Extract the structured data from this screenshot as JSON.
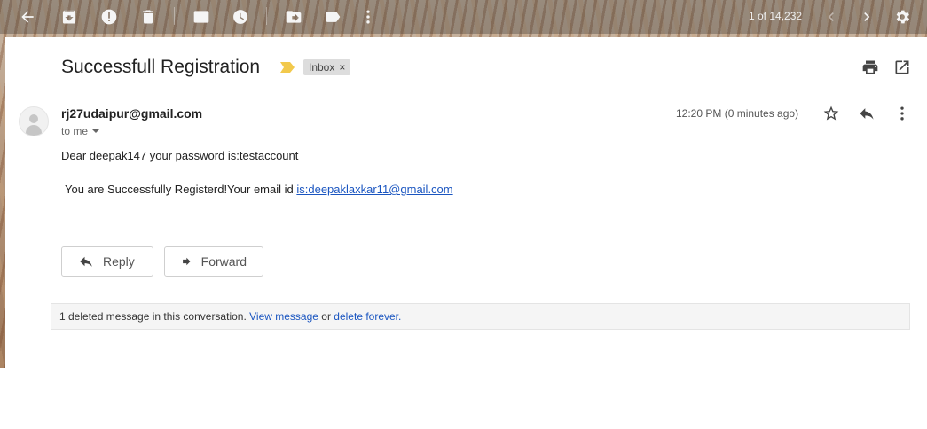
{
  "toolbar": {
    "icons": [
      "back-arrow-icon",
      "archive-icon",
      "report-spam-icon",
      "delete-icon",
      "mark-unread-icon",
      "snooze-icon",
      "move-to-icon",
      "labels-icon",
      "more-vert-icon"
    ],
    "count_text": "1 of 14,232"
  },
  "email": {
    "subject": "Successfull Registration",
    "label": "Inbox",
    "label_remove": "×",
    "sender": "rj27udaipur@gmail.com",
    "to": "to me",
    "time": "12:20 PM (0 minutes ago)",
    "body_line1": "Dear deepak147 your password is:testaccount",
    "body_line2_prefix": "You are Successfully Registerd!Your email id ",
    "body_line2_link": "is:deepaklaxkar11@gmail.com"
  },
  "actions": {
    "reply_label": "Reply",
    "forward_label": "Forward"
  },
  "deleted_notice": {
    "text": "1 deleted message in this conversation. ",
    "view_link": "View message",
    "or_text": " or ",
    "delete_link": "delete forever."
  },
  "colors": {
    "link": "#1a55c0",
    "importance_marker": "#f2c94c",
    "label_chip_bg": "#dddddd"
  }
}
